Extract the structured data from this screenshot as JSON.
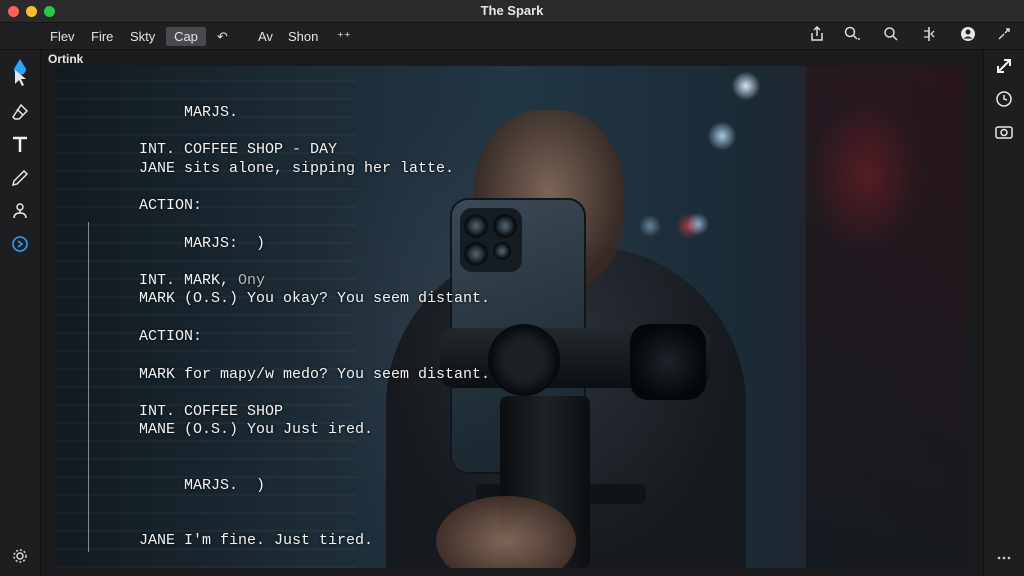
{
  "window": {
    "title": "The Spark"
  },
  "toolbar": {
    "menu": [
      {
        "label": "Flev"
      },
      {
        "label": "Fire"
      },
      {
        "label": "Skty"
      },
      {
        "label": "Cap"
      },
      {
        "label": "↶"
      },
      {
        "label": "Av"
      },
      {
        "label": "Shon"
      },
      {
        "label": "⁺⁺"
      }
    ],
    "active_item": "Cap",
    "right_icons": [
      "share-icon",
      "search-zoom-icon",
      "search-icon",
      "split-icon",
      "account-icon",
      "collapse-icon"
    ]
  },
  "left_tools": [
    "drop-icon",
    "select-arrow-icon",
    "eraser-icon",
    "text-tool-icon",
    "pen-icon",
    "node-icon",
    "script-icon",
    "settings-icon"
  ],
  "right_tools": [
    "expand-arrow-icon",
    "clock-icon",
    "camera-icon",
    "more-icon"
  ],
  "panel": {
    "label": "Ortink"
  },
  "script": {
    "lines": [
      {
        "text": "MARJS.",
        "ghost": ""
      },
      {
        "text": "INT. COFFEE SHOP - DAY",
        "ghost": ""
      },
      {
        "text": "JANE sits alone, sipping her latte.",
        "ghost": ""
      },
      {
        "text": "ACTION:",
        "ghost": ""
      },
      {
        "text": "MARJS:  )",
        "ghost": ""
      },
      {
        "text": "INT. MARK, ",
        "ghost": "Ony"
      },
      {
        "text": "MARK (O.S.) You okay? You seem distant.",
        "ghost": ""
      },
      {
        "text": "ACTION:",
        "ghost": ""
      },
      {
        "text": "MARK for mapy/w medo? You seem distant.",
        "ghost": ""
      },
      {
        "text": "INT. COFFEE SHOP",
        "ghost": ""
      },
      {
        "text": "MANE (O.S.) You Just ired.",
        "ghost": ""
      },
      {
        "text": "MARJS.  )",
        "ghost": ""
      },
      {
        "text": "JANE I'm fine. Just tired.",
        "ghost": ""
      }
    ]
  },
  "colors": {
    "accent": "#2ea3ff",
    "close": "#ff5f57",
    "minimize": "#febc2e",
    "zoom": "#28c840"
  }
}
